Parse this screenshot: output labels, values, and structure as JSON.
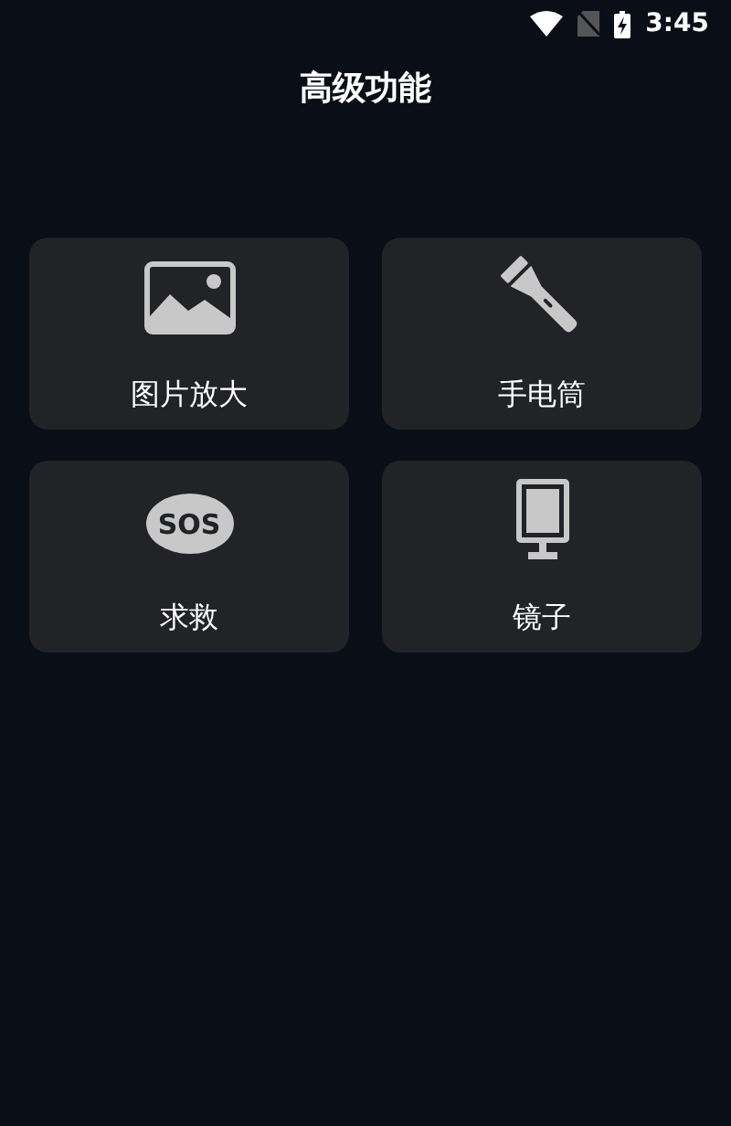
{
  "status_bar": {
    "time": "3:45"
  },
  "title": "高级功能",
  "tiles": [
    {
      "kind": "image",
      "label": "图片放大"
    },
    {
      "kind": "flashlight",
      "label": "手电筒"
    },
    {
      "kind": "sos",
      "label": "求救",
      "icon_text": "SOS"
    },
    {
      "kind": "mirror",
      "label": "镜子"
    }
  ]
}
